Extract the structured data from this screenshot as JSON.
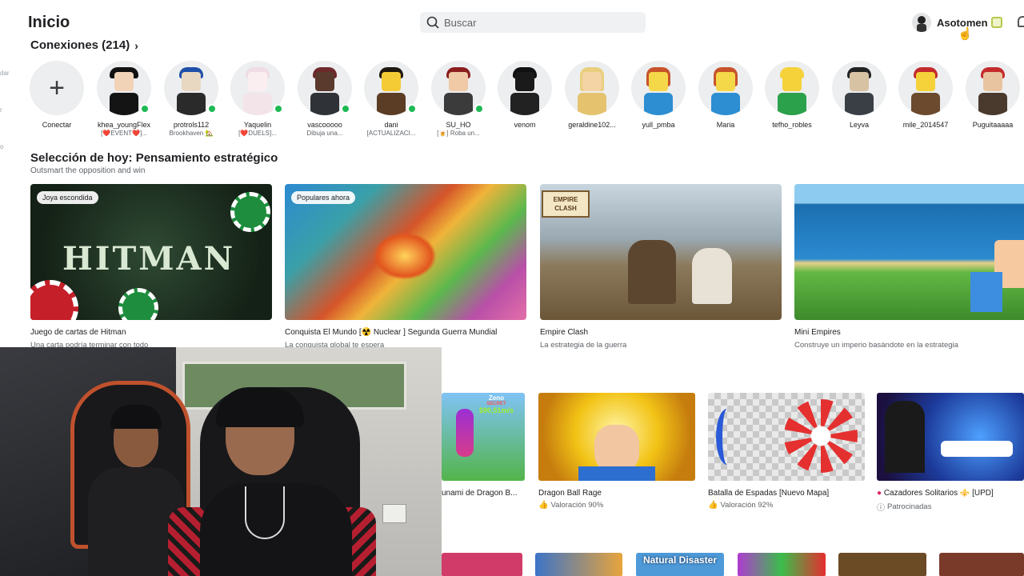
{
  "header": {
    "title": "Inicio",
    "search_placeholder": "Buscar",
    "username": "Asotomen"
  },
  "left_edge_fragments": [
    "dar",
    "r",
    "o"
  ],
  "connections": {
    "heading": "Conexiones (214)",
    "connect_label": "Conectar",
    "friends": [
      {
        "name": "khea_youngFlex",
        "status": "[❤️EVENT❤️]...",
        "online": true
      },
      {
        "name": "protrols112",
        "status": "Brookhaven 🏡",
        "online": true
      },
      {
        "name": "Yaquelin",
        "status": "[❤️DUELS]...",
        "online": true
      },
      {
        "name": "vascooooo",
        "status": "Dibuja una...",
        "online": true
      },
      {
        "name": "dani",
        "status": "[ACTUALIZACI...",
        "online": true
      },
      {
        "name": "SU_HO",
        "status": "[🍺] Roba un...",
        "online": true
      },
      {
        "name": "venom",
        "status": "",
        "online": false
      },
      {
        "name": "geraldine102...",
        "status": "",
        "online": false
      },
      {
        "name": "yull_pmba",
        "status": "",
        "online": false
      },
      {
        "name": "Maria",
        "status": "",
        "online": false
      },
      {
        "name": "tefho_robles",
        "status": "",
        "online": false
      },
      {
        "name": "Leyva",
        "status": "",
        "online": false
      },
      {
        "name": "mile_2014547",
        "status": "",
        "online": false
      },
      {
        "name": "Puguitaaaaa",
        "status": "",
        "online": false
      }
    ]
  },
  "today_pick": {
    "heading": "Selección de hoy: Pensamiento estratégico",
    "subheading": "Outsmart the opposition and win",
    "cards": [
      {
        "badge": "Joya escondida",
        "thumb_text": "HITMAN",
        "title": "Juego de cartas de Hitman",
        "subtitle": "Una carta podría terminar con todo"
      },
      {
        "badge": "Populares ahora",
        "title": "Conquista El Mundo [☢️ Nuclear ] Segunda Guerra Mundial",
        "subtitle": "La conquista global te espera"
      },
      {
        "thumb_text": "EMPIRE CLASH",
        "title": "Empire Clash",
        "subtitle": "La estrategia de la guerra"
      },
      {
        "title": "Mini Empires",
        "subtitle": "Construye un imperio basándote en la estrategia"
      }
    ]
  },
  "row2": {
    "cards": [
      {
        "title": "unami de Dragon B...",
        "thumb_label": "Zeno",
        "thumb_sublabel": "SECRET",
        "thumb_value": "$90,51m/s"
      },
      {
        "title": "Dragon Ball Rage",
        "subtitle": "Valoración 90%"
      },
      {
        "title": "Batalla de Espadas [Nuevo Mapa]",
        "subtitle": "Valoración 92%"
      },
      {
        "title": "Cazadores Solitarios ⚜️ [UPD]",
        "subtitle": "Patrocinadas"
      }
    ]
  },
  "row3": {
    "thumb_label": "Natural Disaster"
  },
  "colors": {
    "online": "#1db954",
    "text": "#202124",
    "muted": "#5f6368",
    "search_bg": "#f0f1f3"
  }
}
